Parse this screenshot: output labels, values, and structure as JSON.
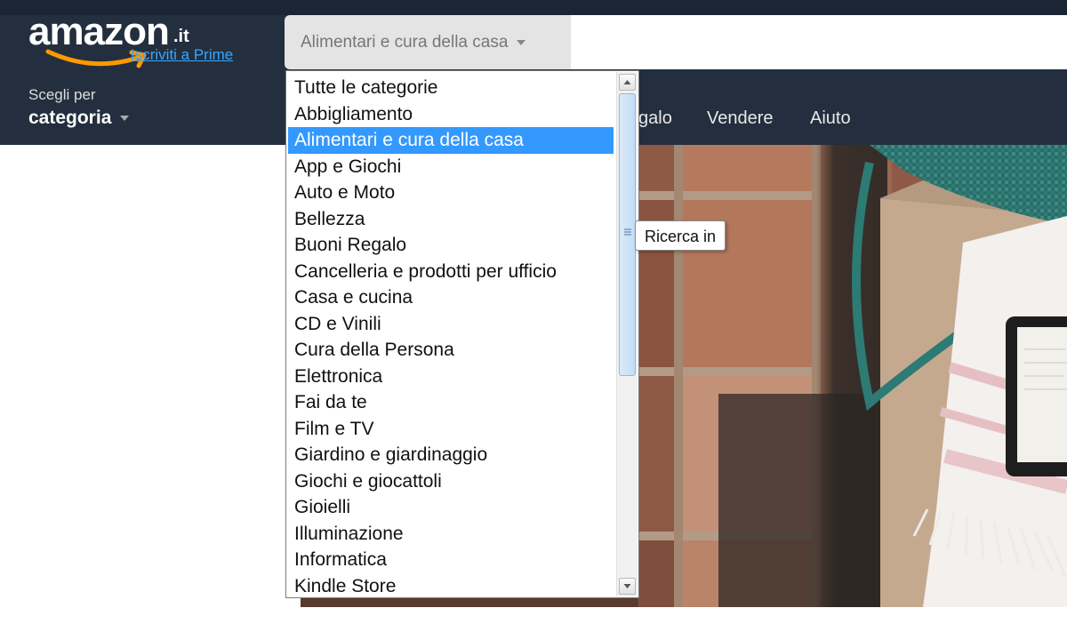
{
  "header": {
    "logo_text": "amazon",
    "logo_tld": ".it",
    "prime_link": "Iscriviti a Prime",
    "search": {
      "selected_category": "Alimentari e cura della casa",
      "query": ""
    },
    "category_menu": {
      "line1": "Scegli per",
      "line2": "categoria"
    },
    "nav": {
      "item_partial": "galo",
      "item_sell": "Vendere",
      "item_help": "Aiuto"
    }
  },
  "dropdown": {
    "items": [
      "Tutte le categorie",
      "Abbigliamento",
      "Alimentari e cura della casa",
      "App e Giochi",
      "Auto e Moto",
      "Bellezza",
      "Buoni Regalo",
      "Cancelleria e prodotti per ufficio",
      "Casa e cucina",
      "CD e Vinili",
      "Cura della Persona",
      "Elettronica",
      "Fai da te",
      "Film e TV",
      "Giardino e giardinaggio",
      "Giochi e giocattoli",
      "Gioielli",
      "Illuminazione",
      "Informatica",
      "Kindle Store"
    ],
    "selected": "Alimentari e cura della casa"
  },
  "tooltip": {
    "text": "Ricerca in"
  },
  "icons": {
    "logo_smile": "smile-arrow-icon",
    "search_cat_caret": "caret-down-icon",
    "category_caret": "caret-down-icon",
    "scroll_up": "arrow-up-icon",
    "scroll_down": "arrow-down-icon",
    "scroll_grip": "grip-icon"
  },
  "colors": {
    "header_bg": "#232f3e",
    "header_strip": "#1b2533",
    "search_category_bg": "#e4e4e4",
    "prime_link": "#37a7ff",
    "selection": "#3399ff",
    "logo_smile": "#ff9900"
  }
}
